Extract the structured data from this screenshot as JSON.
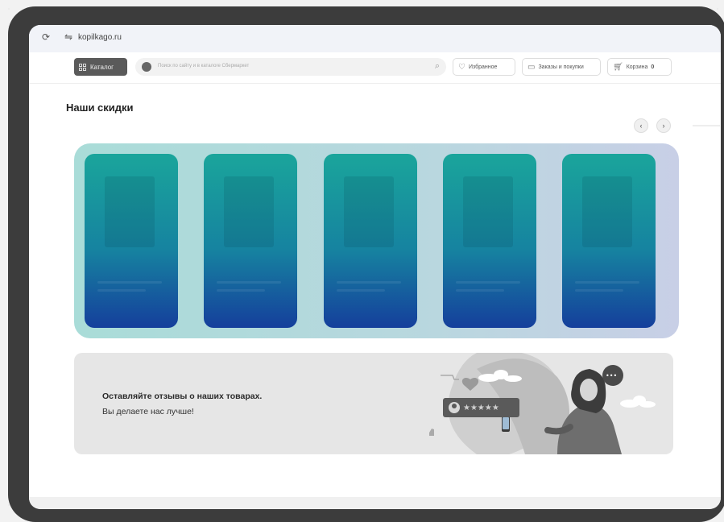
{
  "browser": {
    "url": "kopilkago.ru",
    "reload_icon": "reload-icon",
    "tune_icon": "tune-icon"
  },
  "header": {
    "catalog_label": "Каталог",
    "search_placeholder": "Поиск по сайту и в каталоге Сбермаркет",
    "favorites_label": "Избранное",
    "orders_label": "Заказы и покупки",
    "cart_label": "Корзина",
    "cart_count": "0"
  },
  "discounts": {
    "title": "Наши скидки",
    "prev_label": "‹",
    "next_label": "›",
    "cards": [
      "",
      "",
      "",
      "",
      ""
    ]
  },
  "review_banner": {
    "heading": "Оставляйте отзывы о наших товарах.",
    "subheading": "Вы делаете нас лучше!",
    "stars": "★★★★★",
    "chat_dots": "•••"
  },
  "colors": {
    "device_frame": "#3c3c3c",
    "card_top": "#1aa59b",
    "card_bottom": "#153f9c",
    "carousel_bg": "#b9d7df",
    "banner_bg": "#e6e6e6"
  }
}
